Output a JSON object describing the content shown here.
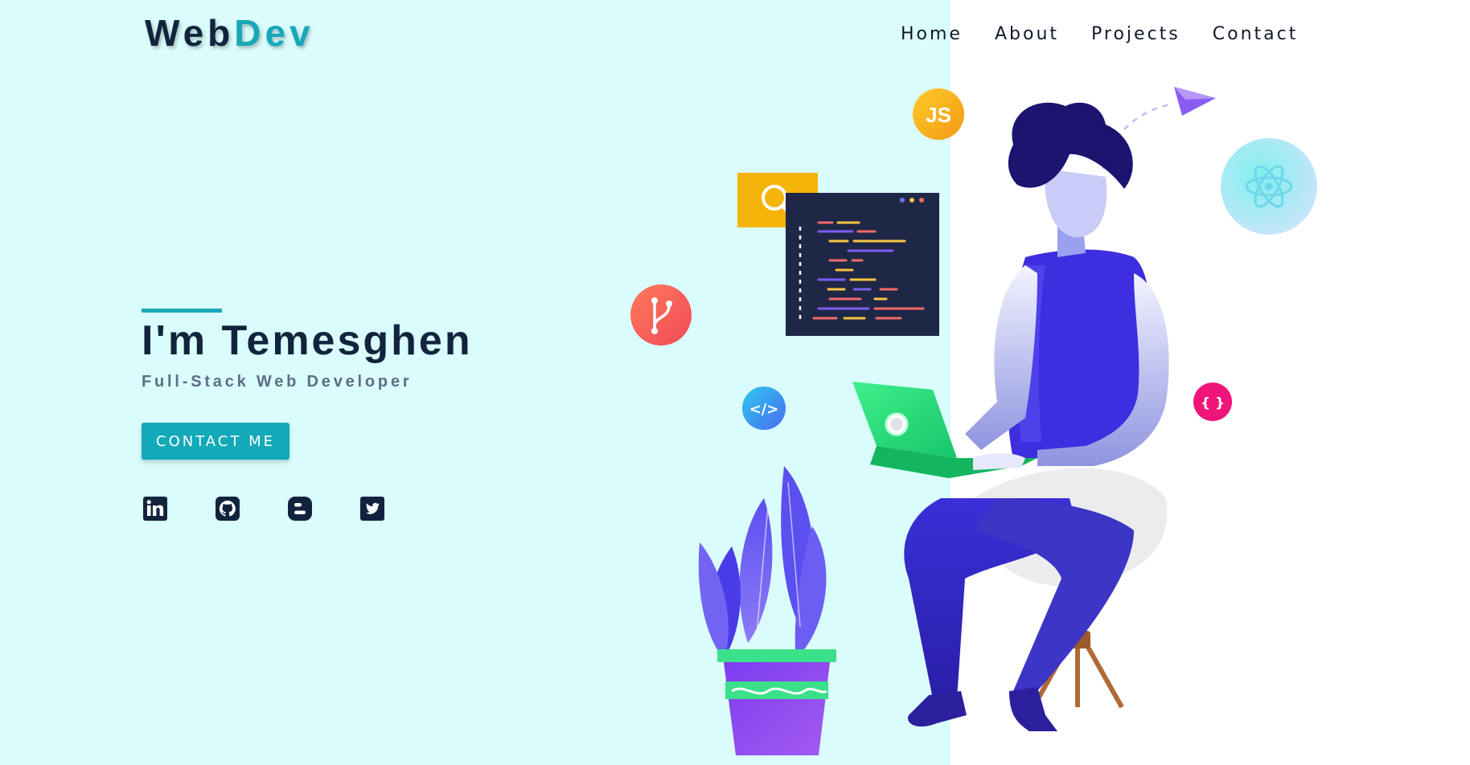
{
  "brand": {
    "part1": "Web",
    "part2": "Dev"
  },
  "nav": {
    "items": [
      {
        "label": "Home"
      },
      {
        "label": "About"
      },
      {
        "label": "Projects"
      },
      {
        "label": "Contact"
      }
    ]
  },
  "hero": {
    "title": "I'm Temesghen",
    "subtitle": "Full-Stack Web Developer",
    "cta_label": "CONTACT ME"
  },
  "social": {
    "icons": [
      "linkedin-icon",
      "github-icon",
      "blogger-icon",
      "twitter-icon"
    ]
  },
  "illustration": {
    "badges": {
      "js": "JS",
      "braces": "{ }",
      "code": "</>"
    }
  },
  "colors": {
    "left_bg": "#dafcfc",
    "accent": "#18a8b8",
    "heading": "#12243d",
    "subtitle": "#5d6d86"
  }
}
